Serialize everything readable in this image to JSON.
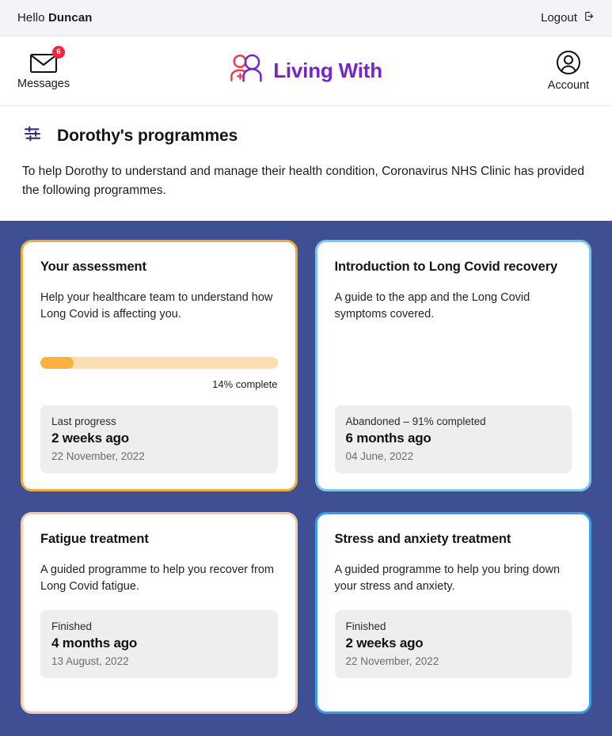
{
  "topbar": {
    "greeting_prefix": "Hello ",
    "user_name": "Duncan",
    "logout_label": "Logout"
  },
  "header": {
    "messages_label": "Messages",
    "messages_badge": "6",
    "brand_name": "Living With",
    "account_label": "Account"
  },
  "intro": {
    "title": "Dorothy's programmes",
    "body": "To help Dorothy to understand and manage their health condition, Coronavirus NHS Clinic has provided the following programmes."
  },
  "colors": {
    "page_background": "#3f4f93",
    "brand_purple": "#7526c9",
    "brand_red": "#f2394a",
    "badge_red": "#f5233b",
    "progress_fill": "#fbb040",
    "progress_track": "#fbdfb3",
    "card_border_orange": "#f0a93b",
    "card_border_light_blue": "#7fc4e8",
    "card_border_peach": "#f5cba8",
    "card_border_blue": "#3b9fe3",
    "status_box": "#eeeeee"
  },
  "cards": [
    {
      "title": "Your assessment",
      "description": "Help your healthcare team to understand how Long Covid is affecting you.",
      "border_color": "#f0a93b",
      "progress": {
        "percent": 14,
        "label": "14% complete"
      },
      "status_head": "Last progress",
      "status_main": "2 weeks ago",
      "status_date": "22 November, 2022"
    },
    {
      "title": "Introduction to Long Covid recovery",
      "description": "A guide to the app and the Long Covid symptoms covered.",
      "border_color": "#7fc4e8",
      "progress": null,
      "status_head": "Abandoned – 91% completed",
      "status_main": "6 months ago",
      "status_date": "04 June, 2022"
    },
    {
      "title": "Fatigue treatment",
      "description": "A guided programme to help you recover from Long Covid fatigue.",
      "border_color": "#f5cba8",
      "progress": null,
      "status_head": "Finished",
      "status_main": "4 months ago",
      "status_date": "13 August, 2022"
    },
    {
      "title": "Stress and anxiety treatment",
      "description": "A guided programme to help you bring down your stress and anxiety.",
      "border_color": "#3b9fe3",
      "progress": null,
      "status_head": "Finished",
      "status_main": "2 weeks ago",
      "status_date": "22 November, 2022"
    }
  ]
}
